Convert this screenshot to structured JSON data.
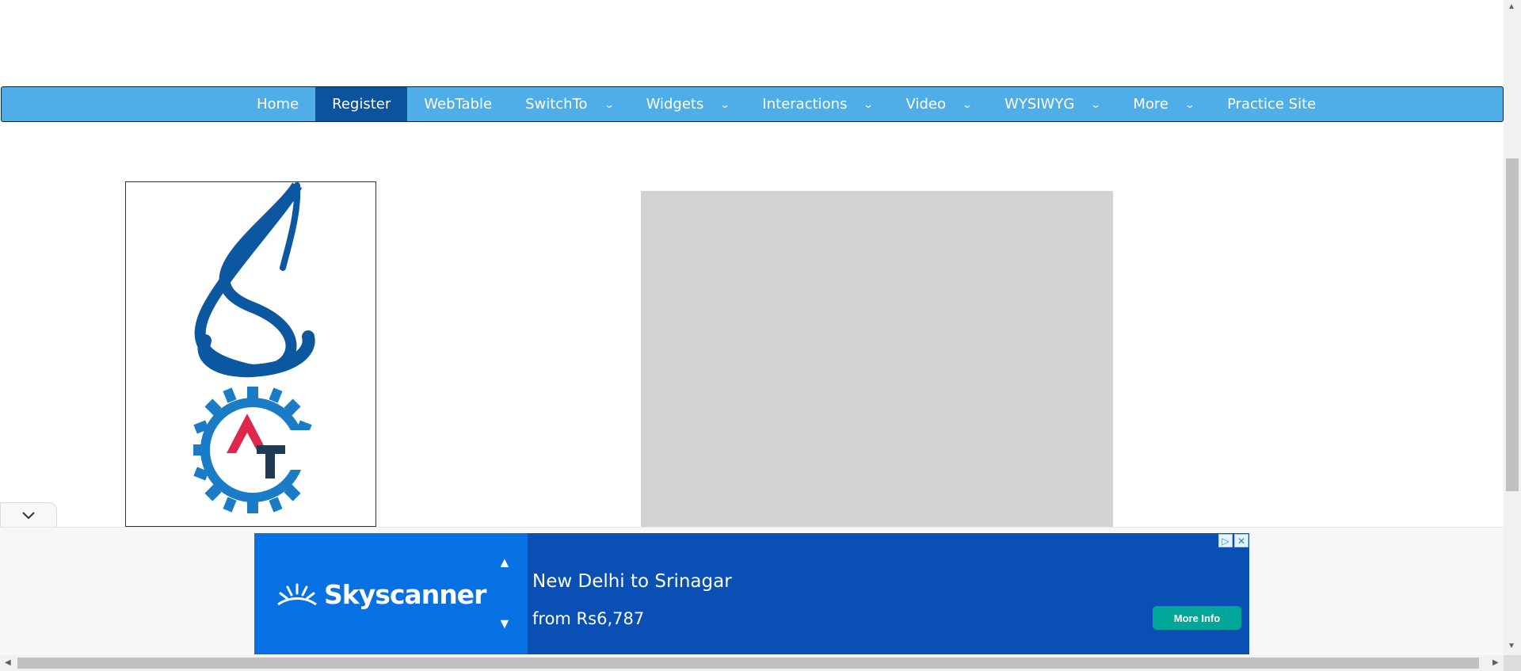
{
  "nav": {
    "items": [
      {
        "label": "Home",
        "dropdown": false,
        "active": false
      },
      {
        "label": "Register",
        "dropdown": false,
        "active": true
      },
      {
        "label": "WebTable",
        "dropdown": false,
        "active": false
      },
      {
        "label": "SwitchTo",
        "dropdown": true,
        "active": false
      },
      {
        "label": "Widgets",
        "dropdown": true,
        "active": false
      },
      {
        "label": "Interactions",
        "dropdown": true,
        "active": false
      },
      {
        "label": "Video",
        "dropdown": true,
        "active": false
      },
      {
        "label": "WYSIWYG",
        "dropdown": true,
        "active": false
      },
      {
        "label": "More",
        "dropdown": true,
        "active": false
      },
      {
        "label": "Practice Site",
        "dropdown": false,
        "active": false
      }
    ],
    "colors": {
      "bar": "#4fade8",
      "active": "#0b549d"
    }
  },
  "logo": {
    "icons": [
      "s-logo-icon",
      "gear-at-logo-icon"
    ]
  },
  "ad": {
    "brand": "Skyscanner",
    "title": "New Delhi to Srinagar",
    "price": "from Rs6,787",
    "cta": "More Info",
    "colors": {
      "left": "#0770e3",
      "right": "#0a4fb3",
      "cta": "#00a698"
    }
  }
}
